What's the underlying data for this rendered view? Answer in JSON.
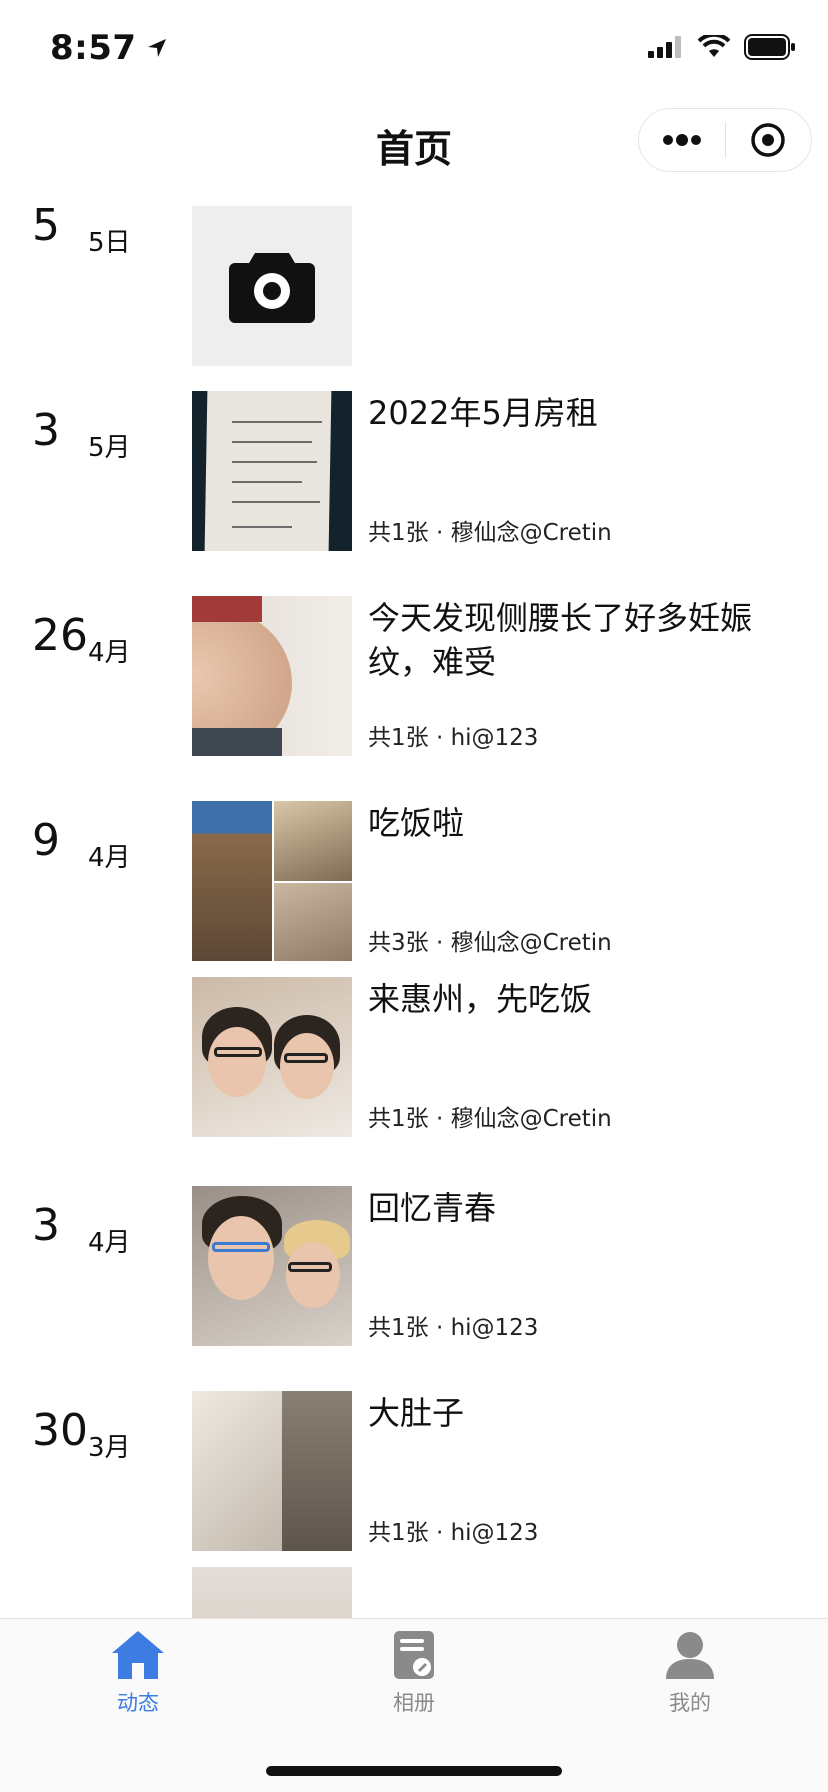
{
  "status_bar": {
    "time": "8:57",
    "icons": [
      "location-arrow-icon",
      "signal-icon",
      "wifi-icon",
      "battery-icon"
    ]
  },
  "nav": {
    "title": "首页",
    "capsule": {
      "more_icon": "more-dots-icon",
      "close_icon": "target-circle-icon"
    }
  },
  "feed": [
    {
      "day": "5",
      "month": "5日",
      "entries": [
        {
          "title": "",
          "meta": "",
          "thumb": "camera-placeholder"
        }
      ]
    },
    {
      "day": "3",
      "month": "5月",
      "entries": [
        {
          "title": "2022年5月房租",
          "meta": "共1张 · 穆仙念@Cretin",
          "thumb": "document-photo"
        }
      ]
    },
    {
      "day": "26",
      "month": "4月",
      "entries": [
        {
          "title": "今天发现侧腰长了好多妊娠纹，难受",
          "meta": "共1张 · hi@123",
          "thumb": "belly-photo"
        }
      ]
    },
    {
      "day": "9",
      "month": "4月",
      "entries": [
        {
          "title": "吃饭啦",
          "meta": "共3张 · 穆仙念@Cretin",
          "thumb": "dinner-mosaic"
        },
        {
          "title": "来惠州，先吃饭",
          "meta": "共1张 · 穆仙念@Cretin",
          "thumb": "couple-selfie"
        }
      ]
    },
    {
      "day": "3",
      "month": "4月",
      "entries": [
        {
          "title": "回忆青春",
          "meta": "共1张 · hi@123",
          "thumb": "couple-selfie-hat"
        }
      ]
    },
    {
      "day": "30",
      "month": "3月",
      "entries": [
        {
          "title": "大肚子",
          "meta": "共1张 · hi@123",
          "thumb": "pillow-photo"
        }
      ]
    }
  ],
  "tabs": [
    {
      "label": "动态",
      "icon": "home-icon",
      "active": true
    },
    {
      "label": "相册",
      "icon": "album-icon",
      "active": false
    },
    {
      "label": "我的",
      "icon": "user-icon",
      "active": false
    }
  ],
  "colors": {
    "accent": "#3d7ce3",
    "inactive": "#8a8a8a"
  }
}
